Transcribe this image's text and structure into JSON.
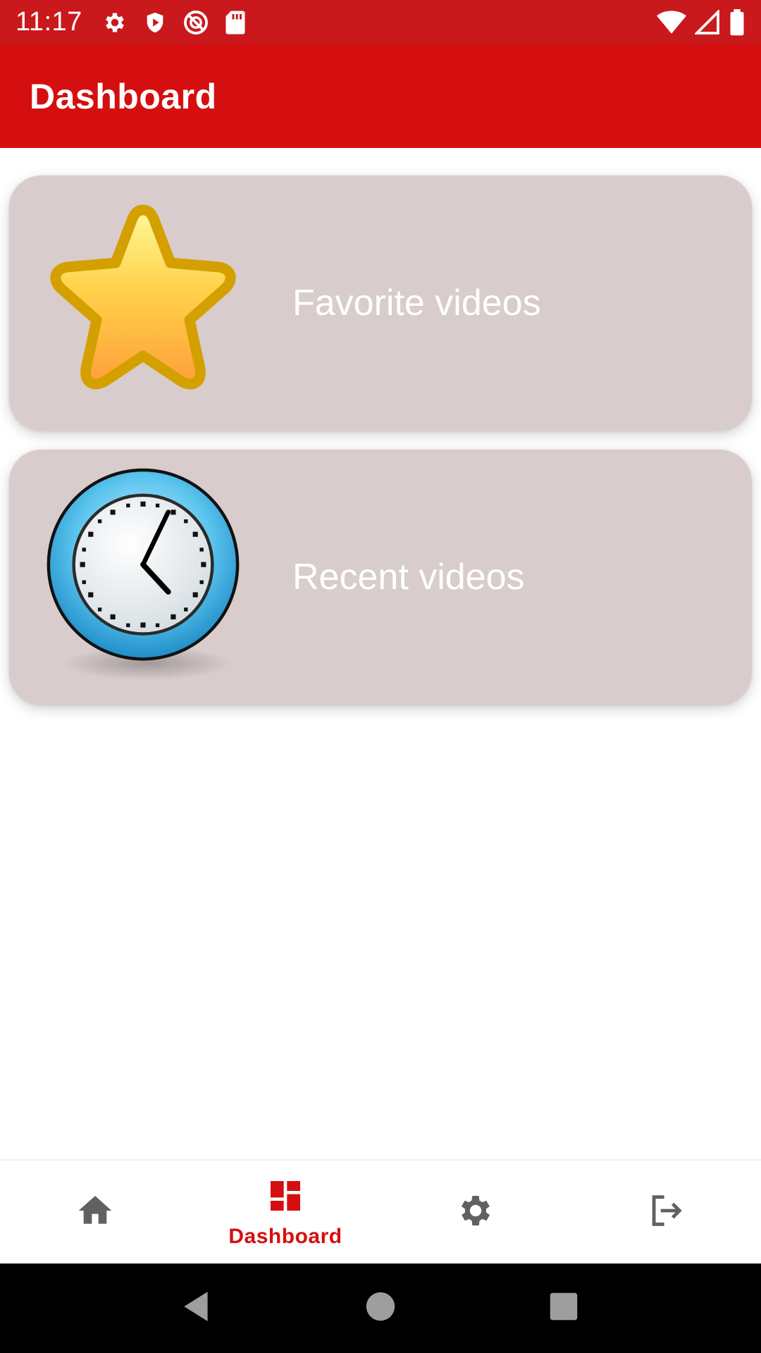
{
  "status_bar": {
    "time": "11:17",
    "left_icons": [
      "gear-icon",
      "shield-play-icon",
      "no-sync-icon",
      "sd-card-icon"
    ],
    "right_icons": [
      "wifi-icon",
      "signal-icon",
      "battery-icon"
    ]
  },
  "app_bar": {
    "title": "Dashboard"
  },
  "cards": [
    {
      "label": "Favorite videos",
      "icon": "star-icon"
    },
    {
      "label": "Recent videos",
      "icon": "clock-icon"
    }
  ],
  "bottom_nav": {
    "items": [
      {
        "icon": "home-icon",
        "label": "",
        "active": false
      },
      {
        "icon": "dashboard-icon",
        "label": "Dashboard",
        "active": true
      },
      {
        "icon": "settings-icon",
        "label": "",
        "active": false
      },
      {
        "icon": "logout-icon",
        "label": "",
        "active": false
      }
    ],
    "active_color": "#d50f10",
    "inactive_color": "#616161"
  },
  "colors": {
    "status_bar": "#c9191c",
    "app_bar": "#d50f10",
    "card_background": "#d8cccd"
  },
  "system_nav": {
    "buttons": [
      "back-icon",
      "home-circle-icon",
      "recents-icon"
    ]
  }
}
